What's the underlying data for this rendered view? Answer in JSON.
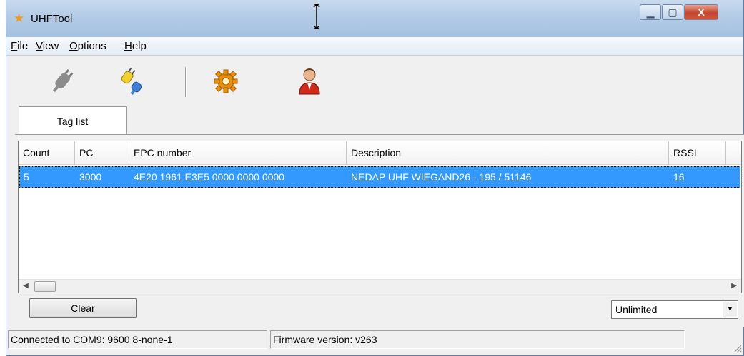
{
  "window": {
    "title": "UHFTool",
    "controls": {
      "minimize": "▁",
      "maximize": "▢",
      "close": "X"
    }
  },
  "menu": [
    {
      "pre": "",
      "u": "F",
      "post": "ile"
    },
    {
      "pre": "",
      "u": "V",
      "post": "iew"
    },
    {
      "pre": "",
      "u": "O",
      "post": "ptions"
    },
    {
      "pre": "",
      "u": "H",
      "post": "elp"
    }
  ],
  "toolbar": {
    "icons": [
      "disconnect-plug-icon",
      "connect-plug-icon",
      "settings-gear-icon",
      "user-icon"
    ]
  },
  "tabs": [
    {
      "label": "Tag list"
    }
  ],
  "tag_table": {
    "columns": [
      "Count",
      "PC",
      "EPC number",
      "Description",
      "RSSI"
    ],
    "rows": [
      {
        "count": "5",
        "pc": "3000",
        "epc": "4E20 1961 E3E5 0000 0000 0000",
        "description": "NEDAP UHF WIEGAND26 - 195 / 51146",
        "rssi": "16"
      }
    ]
  },
  "controls": {
    "clear_label": "Clear",
    "limit_selected": "Unlimited"
  },
  "status": {
    "connection": "Connected to COM9: 9600 8-none-1",
    "firmware": "Firmware version: v263"
  },
  "colors": {
    "selection": "#3399ff",
    "titlebar": "#b3cbe6",
    "close_button": "#c4452d"
  }
}
